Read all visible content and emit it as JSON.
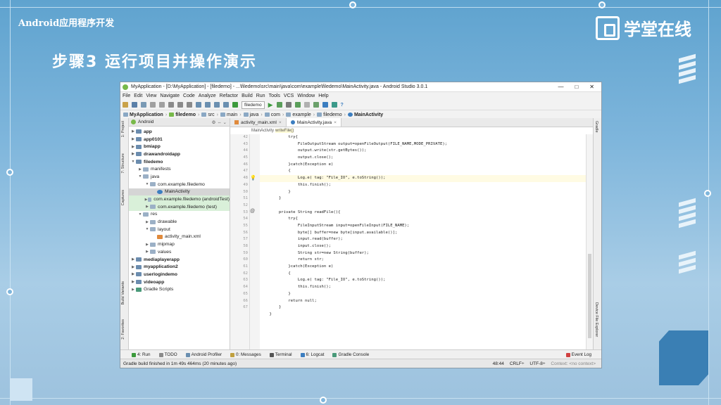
{
  "slide": {
    "header_text": "Android应用程序开发",
    "title": "步骤3  运行项目并操作演示",
    "logo_text": "学堂在线"
  },
  "window": {
    "title": "MyApplication - [D:\\MyApplication] - [filedemo] - ...\\filedemo\\src\\main\\java\\com\\example\\filedemo\\MainActivity.java - Android Studio 3.0.1",
    "controls": [
      "—",
      "□",
      "✕"
    ]
  },
  "menu": [
    "File",
    "Edit",
    "View",
    "Navigate",
    "Code",
    "Analyze",
    "Refactor",
    "Build",
    "Run",
    "Tools",
    "VCS",
    "Window",
    "Help"
  ],
  "toolbar": {
    "run_config": "filedemo"
  },
  "breadcrumb": [
    "MyApplication",
    "filedemo",
    "src",
    "main",
    "java",
    "com",
    "example",
    "filedemo",
    "MainActivity"
  ],
  "left_tabs": [
    "1: Project",
    "7: Structure",
    "Captures",
    "Build Variants",
    "2: Favorites"
  ],
  "right_tabs": [
    "Gradle",
    "Device File Explorer"
  ],
  "project": {
    "view": "Android",
    "tree": [
      {
        "label": "app",
        "indent": 0,
        "arrow": "▶",
        "bold": true
      },
      {
        "label": "app0101",
        "indent": 0,
        "arrow": "▶",
        "bold": true
      },
      {
        "label": "bmiapp",
        "indent": 0,
        "arrow": "▶",
        "bold": true
      },
      {
        "label": "drawandroidapp",
        "indent": 0,
        "arrow": "▶",
        "bold": true
      },
      {
        "label": "filedemo",
        "indent": 0,
        "arrow": "▼",
        "bold": true
      },
      {
        "label": "manifests",
        "indent": 1,
        "arrow": "▶"
      },
      {
        "label": "java",
        "indent": 1,
        "arrow": "▼"
      },
      {
        "label": "com.example.filedemo",
        "indent": 2,
        "arrow": "▼"
      },
      {
        "label": "MainActivity",
        "indent": 3,
        "arrow": "",
        "selected": true
      },
      {
        "label": "com.example.filedemo (androidTest)",
        "indent": 2,
        "arrow": "▶",
        "green": true
      },
      {
        "label": "com.example.filedemo (test)",
        "indent": 2,
        "arrow": "▶",
        "green": true
      },
      {
        "label": "res",
        "indent": 1,
        "arrow": "▼"
      },
      {
        "label": "drawable",
        "indent": 2,
        "arrow": "▶"
      },
      {
        "label": "layout",
        "indent": 2,
        "arrow": "▼"
      },
      {
        "label": "activity_main.xml",
        "indent": 3,
        "arrow": ""
      },
      {
        "label": "mipmap",
        "indent": 2,
        "arrow": "▶"
      },
      {
        "label": "values",
        "indent": 2,
        "arrow": "▶"
      },
      {
        "label": "mediaplayerapp",
        "indent": 0,
        "arrow": "▶",
        "bold": true
      },
      {
        "label": "myapplication2",
        "indent": 0,
        "arrow": "▶",
        "bold": true
      },
      {
        "label": "userlogindemo",
        "indent": 0,
        "arrow": "▶",
        "bold": true
      },
      {
        "label": "videoapp",
        "indent": 0,
        "arrow": "▶",
        "bold": true
      },
      {
        "label": "Gradle Scripts",
        "indent": 0,
        "arrow": "▶"
      }
    ]
  },
  "editor": {
    "tabs": [
      "activity_main.xml",
      "MainActivity.java"
    ],
    "crumbs": [
      "MainActivity",
      "writeFile()"
    ],
    "line_numbers": [
      "42",
      "43",
      "44",
      "45",
      "46",
      "47",
      "48",
      "49",
      "50",
      "51",
      "52",
      "53",
      "54",
      "55",
      "56",
      "57",
      "58",
      "59",
      "60",
      "61",
      "62",
      "63",
      "64",
      "65",
      "66",
      "67"
    ],
    "lines": [
      "            try{",
      "                FileOutputStream output=openFileOutput(FILE_NAME,MODE_PRIVATE);",
      "                output.write(str.getBytes());",
      "                output.close();",
      "            }catch(Exception e)",
      "            {",
      "                Log.e( tag: \"File_IO\", e.toString());",
      "                this.finish();",
      "            }",
      "        }",
      "",
      "        private String readFile(){",
      "            try{",
      "                FileInputStream input=openFileInput(FILE_NAME);",
      "                byte[] buffer=new byte[input.available()];",
      "                input.read(buffer);",
      "                input.close();",
      "                String str=new String(buffer);",
      "                return str;",
      "            }catch(Exception e)",
      "            {",
      "                Log.e( tag: \"File_IO\", e.toString());",
      "                this.finish();",
      "            }",
      "            return null;",
      "        }",
      "    }"
    ]
  },
  "bottom_tools": [
    "4: Run",
    "TODO",
    "Android Profiler",
    "0: Messages",
    "Terminal",
    "6: Logcat",
    "Gradle Console",
    "Event Log"
  ],
  "status": {
    "message": "Gradle build finished in 1m 49s 464ms (20 minutes ago)",
    "position": "48:44",
    "line_sep": "CRLF÷",
    "encoding": "UTF-8÷",
    "context": "Context: <no context>"
  }
}
